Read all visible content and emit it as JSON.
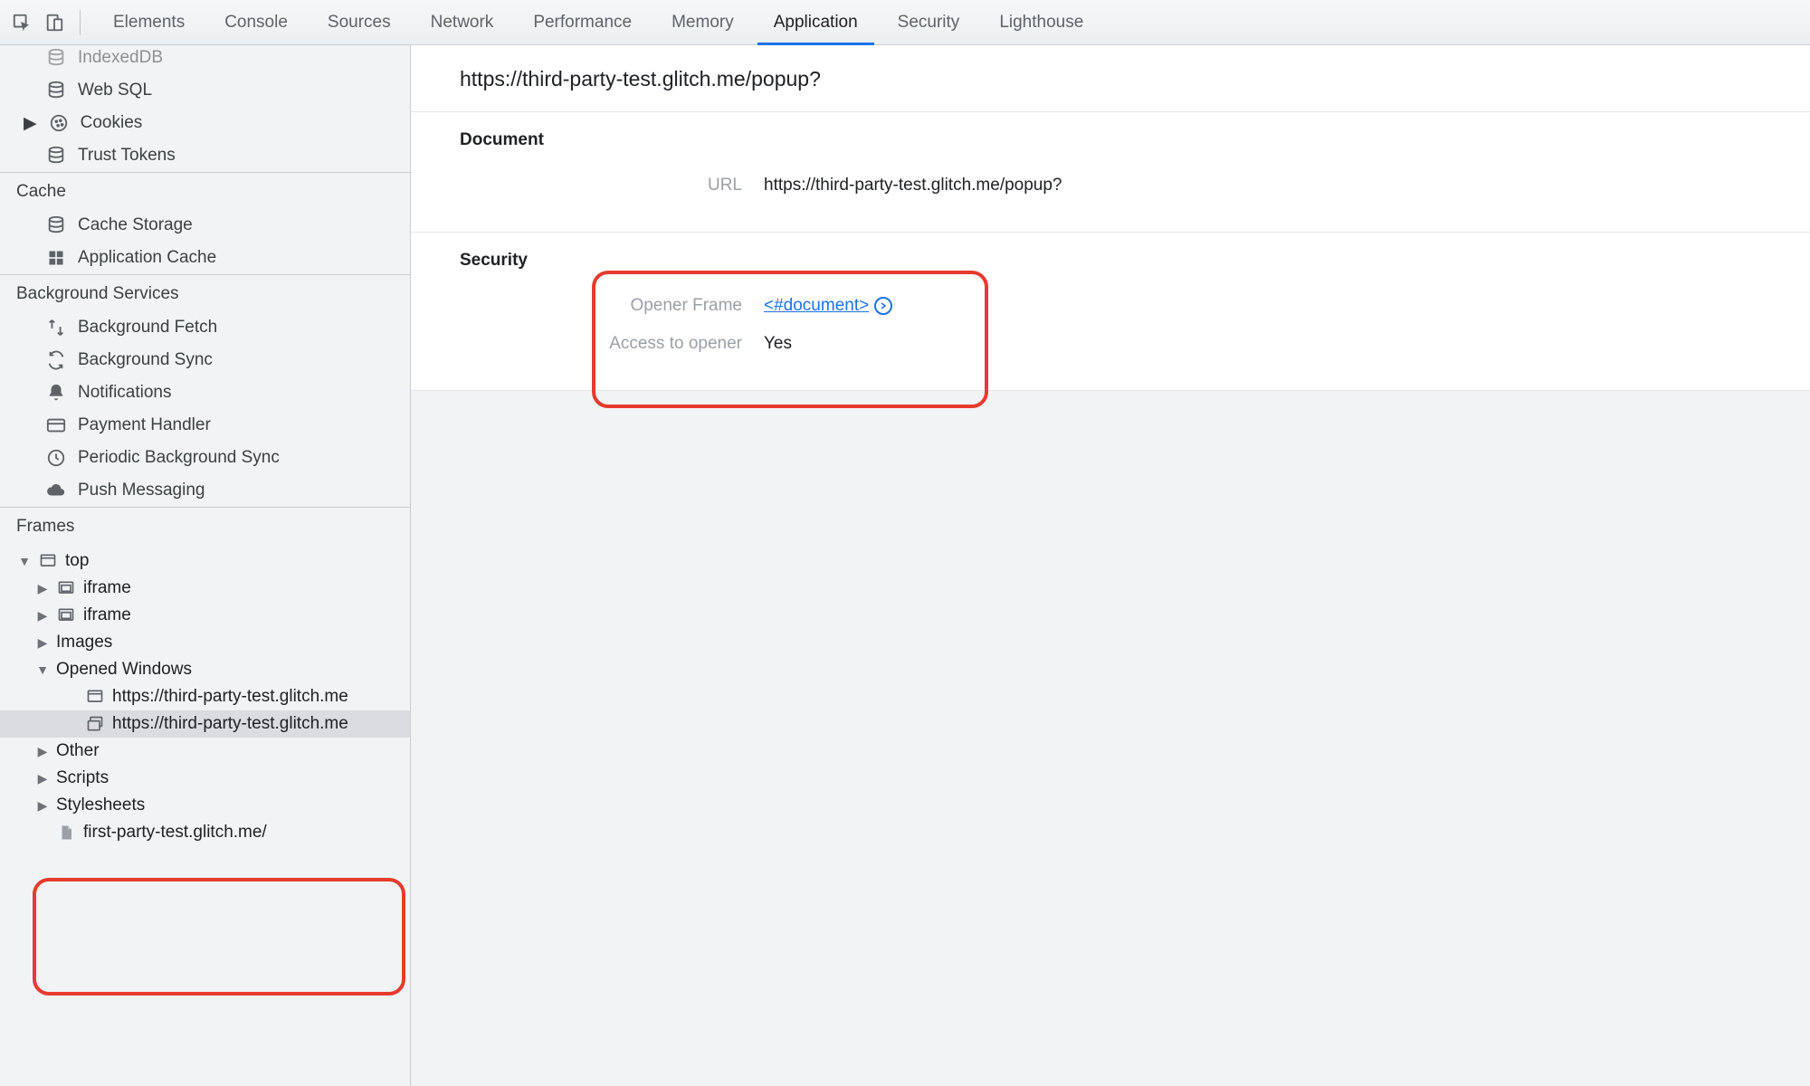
{
  "toolbar": {
    "tabs": [
      "Elements",
      "Console",
      "Sources",
      "Network",
      "Performance",
      "Memory",
      "Application",
      "Security",
      "Lighthouse"
    ],
    "active_tab": "Application"
  },
  "sidebar": {
    "storage_items": [
      {
        "icon": "database",
        "label": "IndexedDB"
      },
      {
        "icon": "database",
        "label": "Web SQL"
      },
      {
        "icon": "cookie",
        "label": "Cookies",
        "expandable": true
      },
      {
        "icon": "database",
        "label": "Trust Tokens"
      }
    ],
    "cache_label": "Cache",
    "cache_items": [
      {
        "icon": "database",
        "label": "Cache Storage"
      },
      {
        "icon": "grid",
        "label": "Application Cache"
      }
    ],
    "bgservices_label": "Background Services",
    "bgservices_items": [
      {
        "icon": "fetch",
        "label": "Background Fetch"
      },
      {
        "icon": "sync",
        "label": "Background Sync"
      },
      {
        "icon": "bell",
        "label": "Notifications"
      },
      {
        "icon": "card",
        "label": "Payment Handler"
      },
      {
        "icon": "clock",
        "label": "Periodic Background Sync"
      },
      {
        "icon": "cloud",
        "label": "Push Messaging"
      }
    ],
    "frames_label": "Frames",
    "frames_tree": {
      "top_label": "top",
      "children": [
        {
          "label": "iframe",
          "icon": "frame",
          "expandable": true
        },
        {
          "label": "iframe",
          "icon": "frame",
          "expandable": true
        },
        {
          "label": "Images",
          "expandable": true
        },
        {
          "label": "Opened Windows",
          "expanded": true,
          "children": [
            {
              "label": "https://third-party-test.glitch.me",
              "icon": "window"
            },
            {
              "label": "https://third-party-test.glitch.me",
              "icon": "windows",
              "selected": true
            }
          ]
        },
        {
          "label": "Other",
          "expandable": true
        },
        {
          "label": "Scripts",
          "expandable": true
        },
        {
          "label": "Stylesheets",
          "expandable": true
        },
        {
          "label": "first-party-test.glitch.me/",
          "icon": "file"
        }
      ]
    }
  },
  "main": {
    "title": "https://third-party-test.glitch.me/popup?",
    "document_section": {
      "heading": "Document",
      "url_label": "URL",
      "url_value": "https://third-party-test.glitch.me/popup?"
    },
    "security_section": {
      "heading": "Security",
      "opener_frame_label": "Opener Frame",
      "opener_frame_value": "<#document>",
      "access_label": "Access to opener",
      "access_value": "Yes"
    }
  }
}
